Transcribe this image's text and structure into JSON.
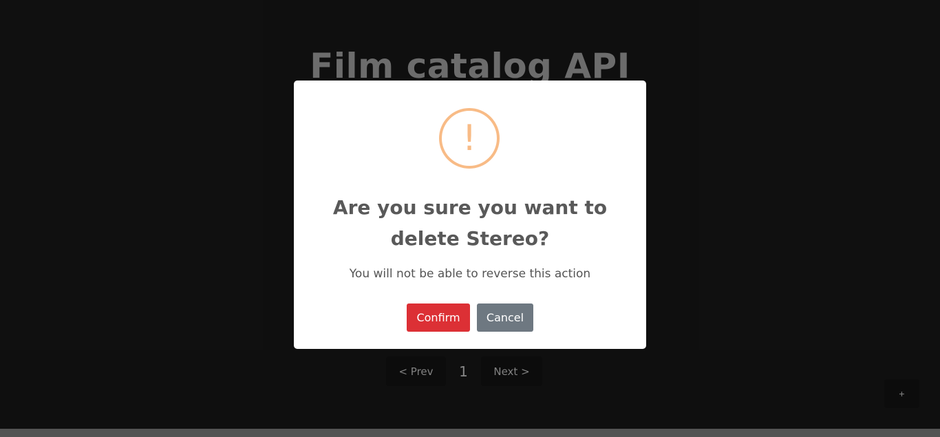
{
  "app": {
    "title": "Film catalog API"
  },
  "pagination": {
    "prev_label": "< Prev",
    "current_page": "1",
    "next_label": "Next >"
  },
  "fab": {
    "label": "+"
  },
  "dialog": {
    "icon_glyph": "!",
    "icon_name": "warning-icon",
    "title": "Are you sure you want to delete Stereo?",
    "text": "You will not be able to reverse this action",
    "confirm_label": "Confirm",
    "cancel_label": "Cancel"
  },
  "colors": {
    "confirm": "#dc3035",
    "cancel": "#6e7881",
    "warning": "#f8bb86",
    "background": "#1a1a1a"
  }
}
